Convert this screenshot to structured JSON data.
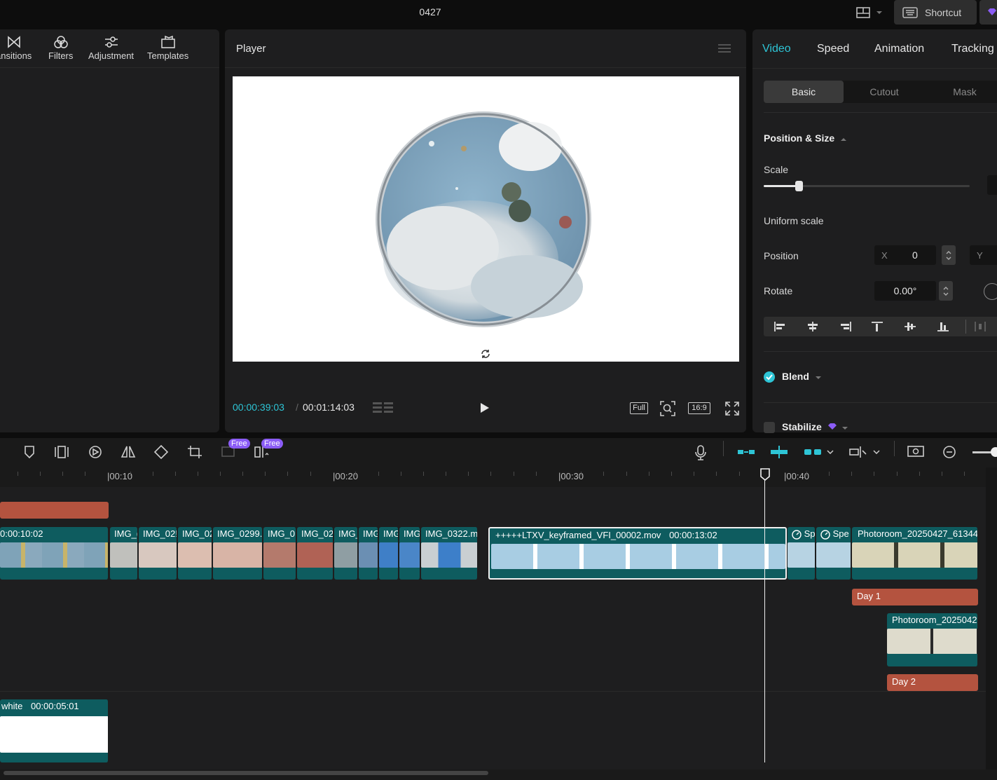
{
  "app": {
    "project_title": "0427",
    "shortcut_label": "Shortcut"
  },
  "left_panel": {
    "tabs": [
      {
        "label": "ansitions",
        "icon": "transitions-icon"
      },
      {
        "label": "Filters",
        "icon": "filters-icon"
      },
      {
        "label": "Adjustment",
        "icon": "adjustment-icon"
      },
      {
        "label": "Templates",
        "icon": "templates-icon"
      }
    ]
  },
  "player": {
    "title": "Player",
    "current_time": "00:00:39:03",
    "separator": "/",
    "total_time": "00:01:14:03",
    "full_label": "Full",
    "ratio_label": "16:9"
  },
  "inspector": {
    "tabs": [
      "Video",
      "Speed",
      "Animation",
      "Tracking"
    ],
    "active_tab": "Video",
    "subtabs": [
      "Basic",
      "Cutout",
      "Mask"
    ],
    "active_subtab": "Basic",
    "section_title": "Position & Size",
    "scale_label": "Scale",
    "scale_level": 0.17,
    "uniform_scale_label": "Uniform scale",
    "position_label": "Position",
    "position_x_axis": "X",
    "position_x_value": "0",
    "position_y_axis": "Y",
    "rotate_label": "Rotate",
    "rotate_value": "0.00°",
    "blend_label": "Blend",
    "blend_checked": true,
    "stabilize_label": "Stabilize",
    "accent_color": "#2ec5d6"
  },
  "timeline": {
    "free_badge_1": "Free",
    "free_badge_2": "Free",
    "ruler_labels": [
      "00:10",
      "00:20",
      "00:30",
      "00:40"
    ],
    "main_clips": [
      {
        "label": "0:00:10:02"
      },
      {
        "label": "IMG_("
      },
      {
        "label": "IMG_02!"
      },
      {
        "label": "IMG_02"
      },
      {
        "label": "IMG_0299."
      },
      {
        "label": "IMG_0:"
      },
      {
        "label": "IMG_02"
      },
      {
        "label": "IMG_"
      },
      {
        "label": "IMG"
      },
      {
        "label": "IMG"
      },
      {
        "label": "IMG"
      },
      {
        "label": "IMG_0322.m"
      },
      {
        "label": "+++++LTXV_keyframed_VFI_00002.mov",
        "duration": "00:00:13:02"
      },
      {
        "label": "Sp"
      },
      {
        "label": "Spe"
      },
      {
        "label": "Photoroom_20250427_61344"
      }
    ],
    "text_clips": [
      "Day 1",
      "Day 2"
    ],
    "overlay_clip_label": "Photoroom_2025042",
    "white_clip": {
      "label": "white",
      "duration": "00:00:05:01"
    }
  }
}
